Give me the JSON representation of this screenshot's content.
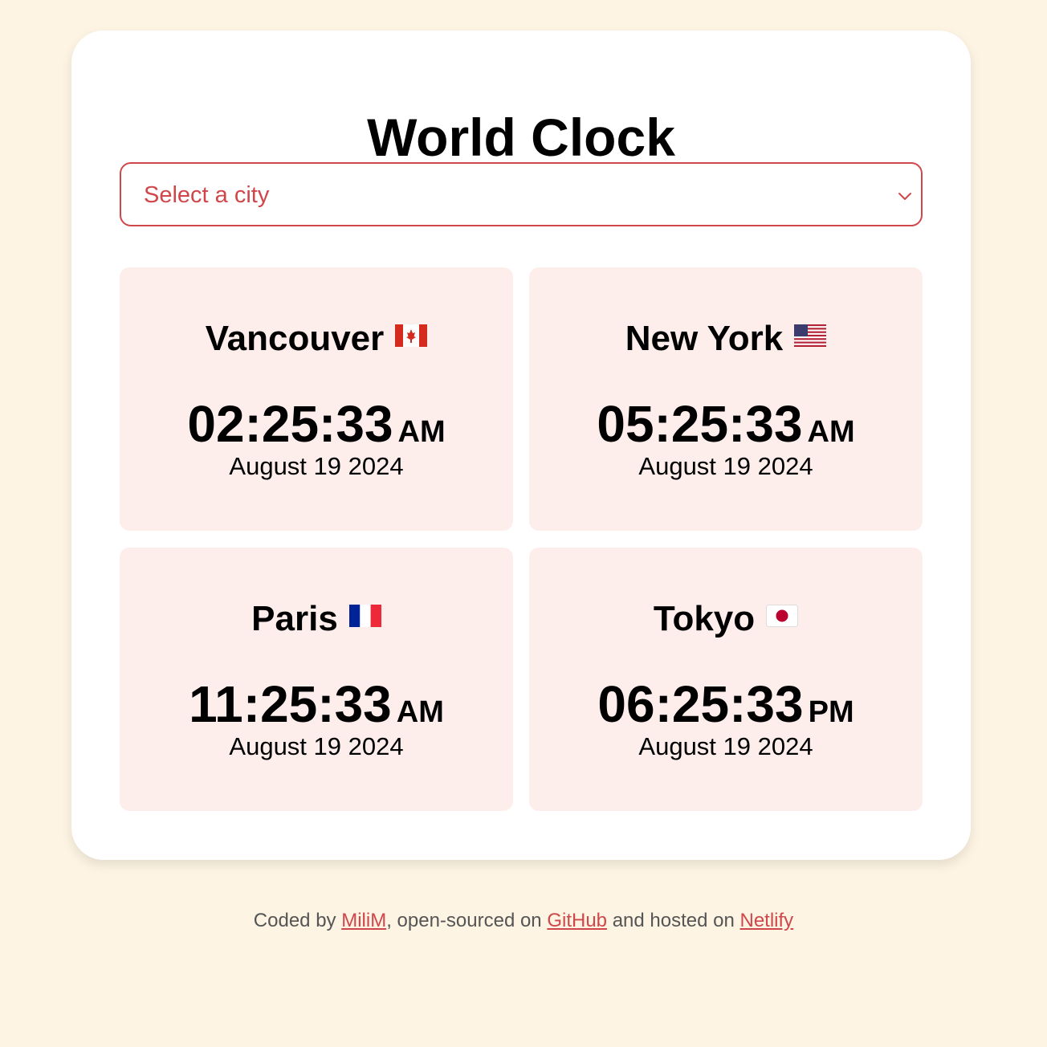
{
  "app": {
    "title": "World Clock"
  },
  "select": {
    "placeholder": "Select a city"
  },
  "cities": [
    {
      "name": "Vancouver",
      "flag": "canada-flag-icon",
      "time": "02:25:33",
      "ampm": "AM",
      "date": "August 19 2024"
    },
    {
      "name": "New York",
      "flag": "usa-flag-icon",
      "time": "05:25:33",
      "ampm": "AM",
      "date": "August 19 2024"
    },
    {
      "name": "Paris",
      "flag": "france-flag-icon",
      "time": "11:25:33",
      "ampm": "AM",
      "date": "August 19 2024"
    },
    {
      "name": "Tokyo",
      "flag": "japan-flag-icon",
      "time": "06:25:33",
      "ampm": "PM",
      "date": "August 19 2024"
    }
  ],
  "footer": {
    "prefix": "Coded by ",
    "author": "MiliM",
    "middle": ", open-sourced on ",
    "repo": "GitHub",
    "suffix": " and hosted on ",
    "host": "Netlify"
  },
  "colors": {
    "background": "#fdf4e3",
    "accent": "#d0474b",
    "card": "#fdeeec"
  }
}
